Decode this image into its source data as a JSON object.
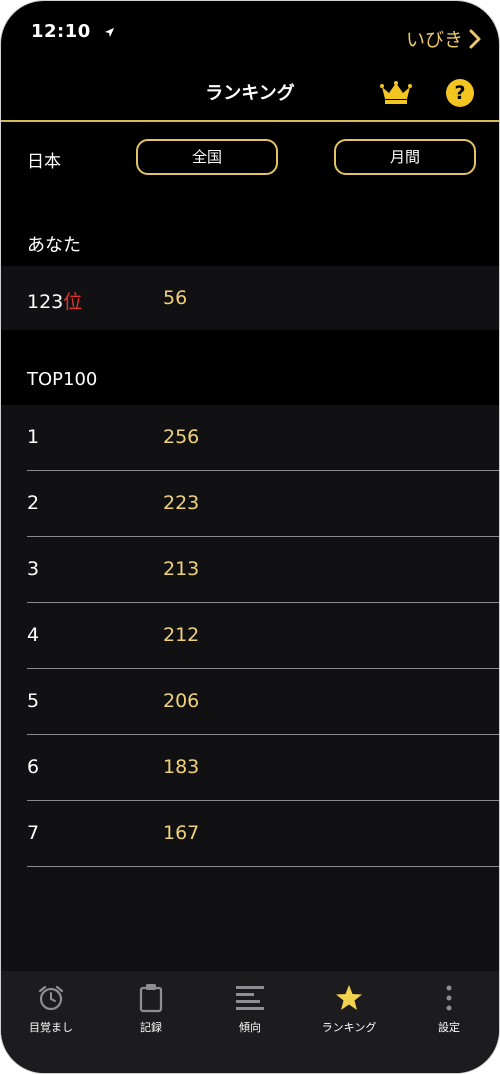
{
  "status": {
    "time": "12:10"
  },
  "header": {
    "back_label": "いびき",
    "title": "ランキング"
  },
  "filters": {
    "region": "日本",
    "scope": "全国",
    "period": "月間"
  },
  "you": {
    "heading": "あなた",
    "rank": "123",
    "rank_suffix": "位",
    "score": "56"
  },
  "top": {
    "heading": "TOP100",
    "rows": [
      {
        "rank": "1",
        "score": "256"
      },
      {
        "rank": "2",
        "score": "223"
      },
      {
        "rank": "3",
        "score": "213"
      },
      {
        "rank": "4",
        "score": "212"
      },
      {
        "rank": "5",
        "score": "206"
      },
      {
        "rank": "6",
        "score": "183"
      },
      {
        "rank": "7",
        "score": "167"
      }
    ]
  },
  "tabs": [
    {
      "label": "目覚まし",
      "icon": "alarm-clock-icon"
    },
    {
      "label": "記録",
      "icon": "clipboard-icon"
    },
    {
      "label": "傾向",
      "icon": "lines-icon"
    },
    {
      "label": "ランキング",
      "icon": "star-icon"
    },
    {
      "label": "設定",
      "icon": "dots-vertical-icon"
    }
  ],
  "colors": {
    "accent_gold": "#e9c86a",
    "score_yellow": "#f0d27a",
    "rank_red": "#e0322f",
    "help_yellow": "#f3c520"
  }
}
